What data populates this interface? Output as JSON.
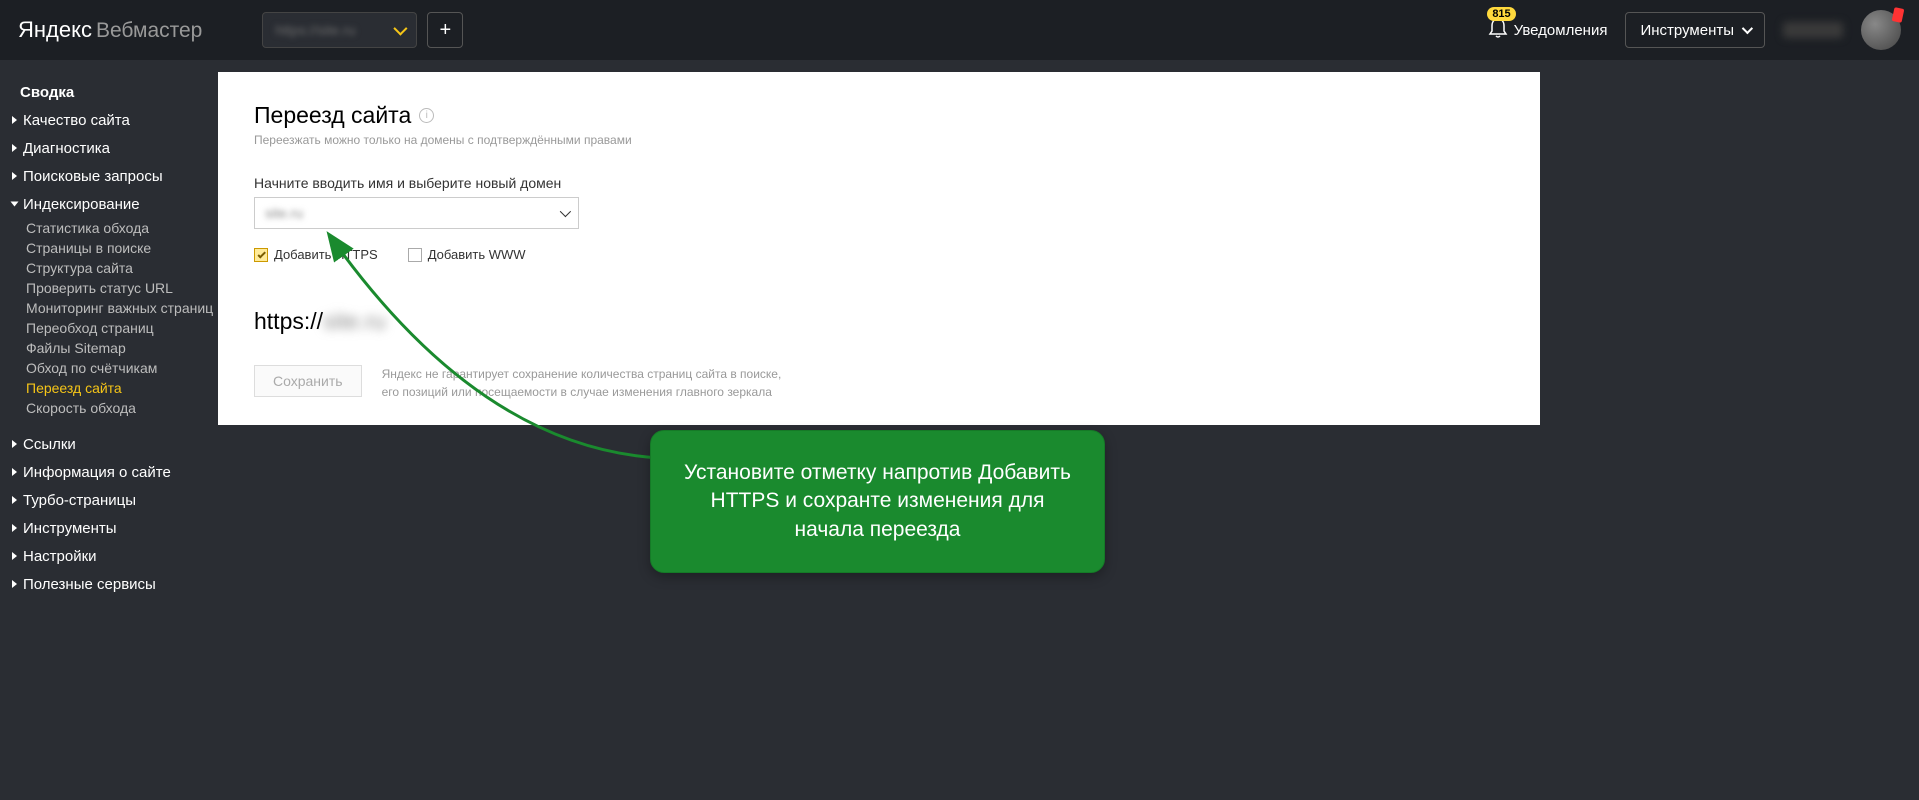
{
  "header": {
    "logo_main": "Яндекс",
    "logo_sub": "Вебмастер",
    "site_selected": "https://site.ru",
    "notif_count": "815",
    "notif_label": "Уведомления",
    "tools_label": "Инструменты"
  },
  "sidebar": {
    "summary": "Сводка",
    "items": [
      {
        "label": "Качество сайта"
      },
      {
        "label": "Диагностика"
      },
      {
        "label": "Поисковые запросы"
      },
      {
        "label": "Индексирование",
        "sub": [
          {
            "label": "Статистика обхода"
          },
          {
            "label": "Страницы в поиске"
          },
          {
            "label": "Структура сайта"
          },
          {
            "label": "Проверить статус URL"
          },
          {
            "label": "Мониторинг важных страниц"
          },
          {
            "label": "Переобход страниц"
          },
          {
            "label": "Файлы Sitemap"
          },
          {
            "label": "Обход по счётчикам"
          },
          {
            "label": "Переезд сайта",
            "active": true
          },
          {
            "label": "Скорость обхода"
          }
        ]
      },
      {
        "label": "Ссылки"
      },
      {
        "label": "Информация о сайте"
      },
      {
        "label": "Турбо-страницы"
      },
      {
        "label": "Инструменты"
      },
      {
        "label": "Настройки"
      },
      {
        "label": "Полезные сервисы"
      }
    ]
  },
  "main": {
    "title": "Переезд сайта",
    "subtitle": "Переезжать можно только на домены с подтверждёнными правами",
    "form_label": "Начните вводить имя и выберите новый домен",
    "domain_value": "site.ru",
    "add_https": "Добавить HTTPS",
    "add_www": "Добавить WWW",
    "preview_prefix": "https://",
    "preview_domain": "site.ru",
    "save_label": "Сохранить",
    "save_note": "Яндекс не гарантирует сохранение количества страниц сайта в поиске, его позиций или посещаемости в случае изменения главного зеркала"
  },
  "callout": {
    "text": "Установите отметку напротив Добавить HTTPS и сохранте изменения для начала переезда"
  }
}
